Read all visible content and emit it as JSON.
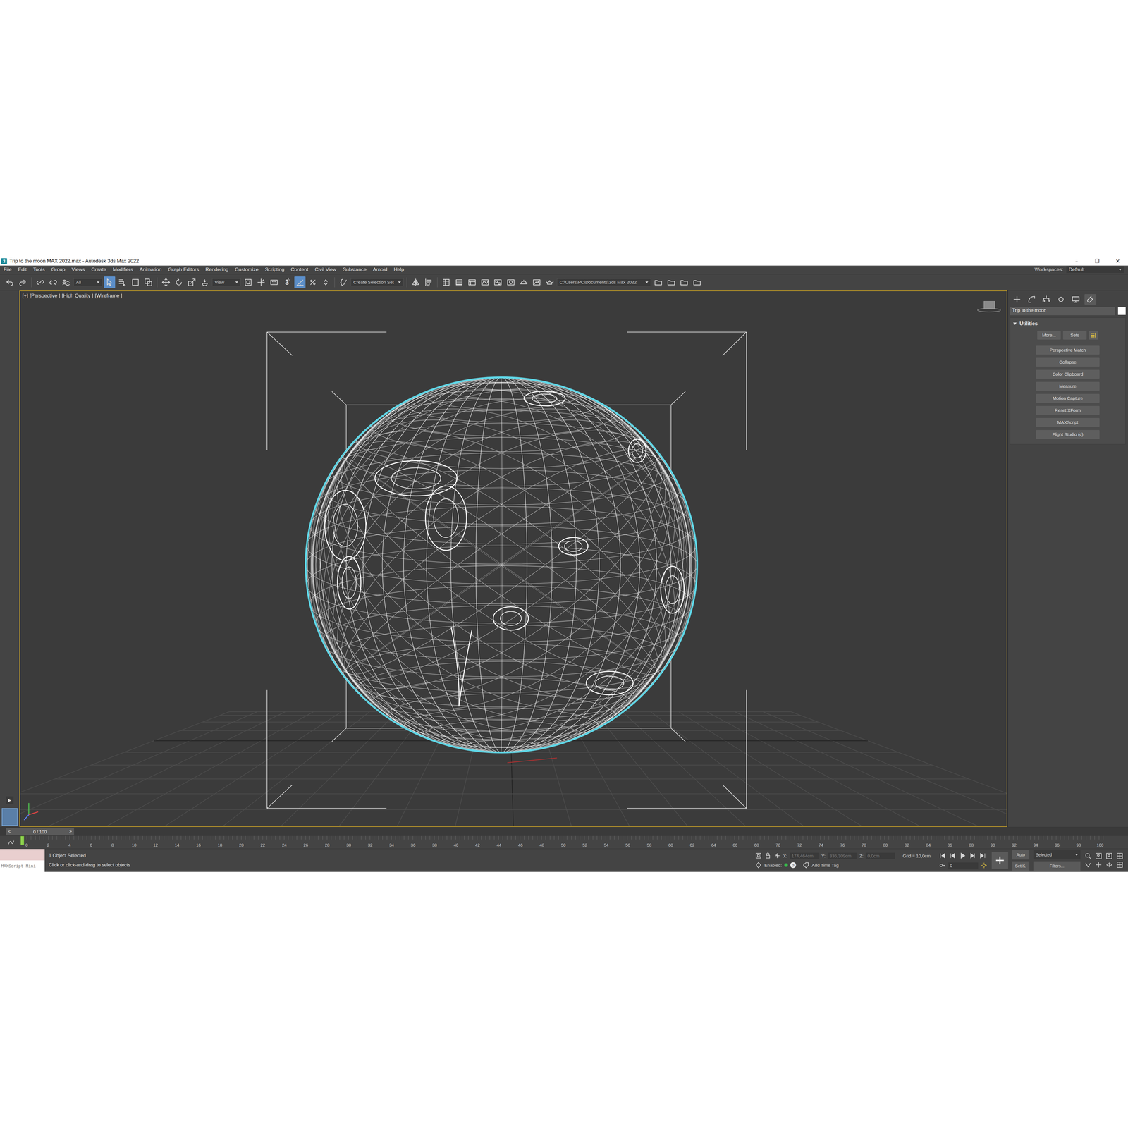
{
  "window": {
    "title": "Trip to the moon MAX 2022.max - Autodesk 3ds Max 2022",
    "app_icon": "3",
    "controls": [
      "–",
      "❐",
      "✕"
    ]
  },
  "menu": [
    "File",
    "Edit",
    "Tools",
    "Group",
    "Views",
    "Create",
    "Modifiers",
    "Animation",
    "Graph Editors",
    "Rendering",
    "Customize",
    "Scripting",
    "Content",
    "Civil View",
    "Substance",
    "Arnold",
    "Help"
  ],
  "workspaces": {
    "label": "Workspaces:",
    "value": "Default"
  },
  "toolbar": {
    "selection_filter": "All",
    "reference_coordinate": "View",
    "snap_toggle": "3",
    "selection_set": "Create Selection Set",
    "project_folder": "C:\\Users\\PC\\Documents\\3ds Max 2022",
    "states": {
      "select": true,
      "angle_snap": true
    }
  },
  "left_strip": {
    "expand": "▶"
  },
  "viewport": {
    "labels": [
      "[+]",
      "[Perspective ]",
      "[High Quality ]",
      "[Wireframe ]"
    ],
    "active": true,
    "object_selected": true
  },
  "command_panel": {
    "tabs": [
      {
        "selected": false
      },
      {
        "selected": false
      },
      {
        "selected": false
      },
      {
        "selected": false
      },
      {
        "selected": false
      },
      {
        "selected": true
      }
    ],
    "object_name": "Trip to the moon",
    "rollout": {
      "title": "Utilities",
      "expanded": true
    },
    "top_buttons": [
      "More...",
      "Sets"
    ],
    "utilities": [
      "Perspective Match",
      "Collapse",
      "Color Clipboard",
      "Measure",
      "Motion Capture",
      "Reset XForm",
      "MAXScript",
      "Flight Studio (c)"
    ]
  },
  "timeline": {
    "position": "0 / 100",
    "level": 0,
    "prev": "<",
    "next": ">",
    "ticks": [
      "0",
      "2",
      "4",
      "6",
      "8",
      "10",
      "12",
      "14",
      "16",
      "18",
      "20",
      "22",
      "24",
      "26",
      "28",
      "30",
      "32",
      "34",
      "36",
      "38",
      "40",
      "42",
      "44",
      "46",
      "48",
      "50",
      "52",
      "54",
      "56",
      "58",
      "60",
      "62",
      "64",
      "66",
      "68",
      "70",
      "72",
      "74",
      "76",
      "78",
      "80",
      "82",
      "84",
      "86",
      "88",
      "90",
      "92",
      "94",
      "96",
      "98",
      "100"
    ]
  },
  "status": {
    "maxscript": "MAXScript Mini",
    "selection": "1 Object Selected",
    "prompt": "Click or click-and-drag to select objects",
    "coords": [
      {
        "label": "X:",
        "value": "174,464cm",
        "disabled": true
      },
      {
        "label": "Y:",
        "value": "336,309cm",
        "disabled": true
      },
      {
        "label": "Z:",
        "value": "0,0cm",
        "disabled": true
      }
    ],
    "grid": "Grid = 10,0cm",
    "enabled": "Enabled:",
    "adaptive_on": true,
    "adaptive_count": "0",
    "time_tag": "Add Time Tag",
    "frame": "0",
    "auto": "Auto",
    "key_mode": "Selected",
    "set_key": "Set K.",
    "filters": "Filters..."
  }
}
